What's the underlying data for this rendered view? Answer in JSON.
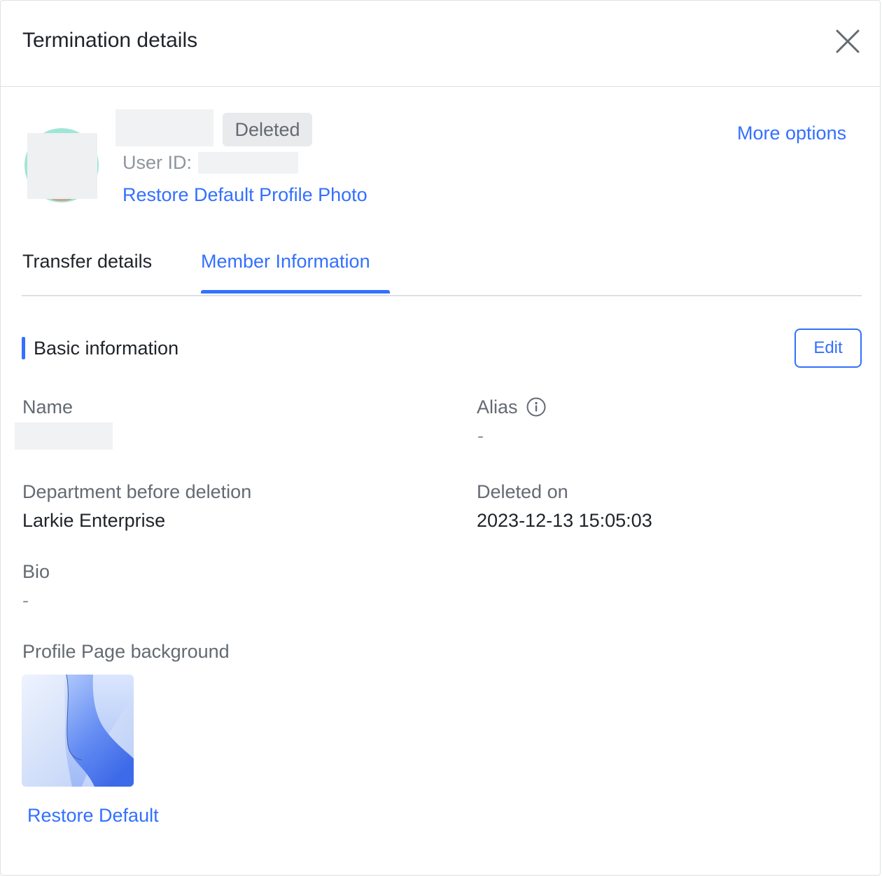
{
  "header": {
    "title": "Termination details",
    "close_icon": "close-icon"
  },
  "profile": {
    "status_badge": "Deleted",
    "user_id_label": "User ID:",
    "restore_photo_link": "Restore Default Profile Photo",
    "more_options_link": "More options"
  },
  "tabs": [
    {
      "label": "Transfer details",
      "active": false
    },
    {
      "label": "Member Information",
      "active": true
    }
  ],
  "section": {
    "title": "Basic information",
    "edit_label": "Edit"
  },
  "fields": {
    "name_label": "Name",
    "alias_label": "Alias",
    "alias_value": "-",
    "department_label": "Department before deletion",
    "department_value": "Larkie Enterprise",
    "deleted_on_label": "Deleted on",
    "deleted_on_value": "2023-12-13 15:05:03",
    "bio_label": "Bio",
    "bio_value": "-",
    "background_label": "Profile Page background",
    "restore_default_link": "Restore Default"
  },
  "colors": {
    "accent": "#3370ff",
    "text": "#1f2329",
    "secondary": "#646a73",
    "badge_bg": "#e9eaec"
  }
}
